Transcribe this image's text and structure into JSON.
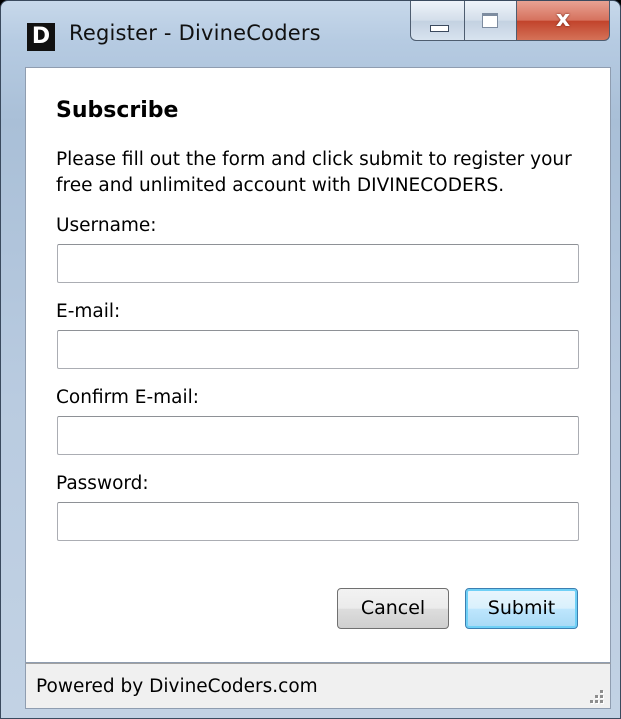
{
  "window": {
    "title": "Register - DivineCoders",
    "icon_letter": "D",
    "icon_name": "app-logo-icon",
    "controls": {
      "minimize_icon": "minimize-icon",
      "maximize_icon": "maximize-icon",
      "close_glyph": "x"
    }
  },
  "form": {
    "heading": "Subscribe",
    "description": "Please fill out the form and click submit to register your free and unlimited account with DIVINECODERS.",
    "fields": {
      "username": {
        "label": "Username:",
        "value": "",
        "placeholder": ""
      },
      "email": {
        "label": "E-mail:",
        "value": "",
        "placeholder": ""
      },
      "confirm_email": {
        "label": "Confirm E-mail:",
        "value": "",
        "placeholder": ""
      },
      "password": {
        "label": "Password:",
        "value": "",
        "placeholder": ""
      }
    },
    "buttons": {
      "cancel": "Cancel",
      "submit": "Submit"
    }
  },
  "statusbar": {
    "text": "Powered by DivineCoders.com"
  },
  "colors": {
    "title_bar": "#b6cbe2",
    "close_button": "#c1432b",
    "submit_border": "#3c7fb1"
  }
}
